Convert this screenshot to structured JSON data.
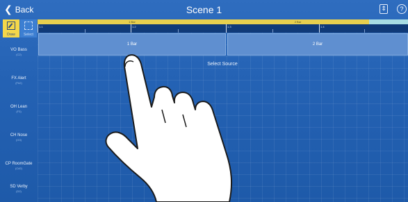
{
  "topbar": {
    "back_label": "Back",
    "back_icon": "chevron-left-icon",
    "title": "Scene 1",
    "sort_icon": "up-down-arrows-icon",
    "help_icon": "question-circle-icon"
  },
  "tools": {
    "draw_label": "Draw",
    "select_label": "Select"
  },
  "ruler": {
    "bars": [
      "1 Bar",
      "2 Bar"
    ],
    "ticks": [
      "1.1",
      "1.2",
      "1.3",
      "1.4"
    ]
  },
  "tracks": [
    {
      "name": "VO Bass",
      "sub": "(C2)"
    },
    {
      "name": "FX Alert",
      "sub": "(F#2)"
    },
    {
      "name": "OH Lean",
      "sub": "(F3)"
    },
    {
      "name": "CH Nose",
      "sub": "(G3)"
    },
    {
      "name": "CP RoomGate",
      "sub": "(C#2)"
    },
    {
      "name": "SD Verby",
      "sub": "(D2)"
    }
  ],
  "clips": [
    "1 Bar",
    "2 Bar"
  ],
  "select_source": "Select Source",
  "colors": {
    "background": "#2462b4",
    "draw_active": "#f4d74a",
    "ruler_bar": "#e8cf4e",
    "clip": "#5f8fd0"
  }
}
